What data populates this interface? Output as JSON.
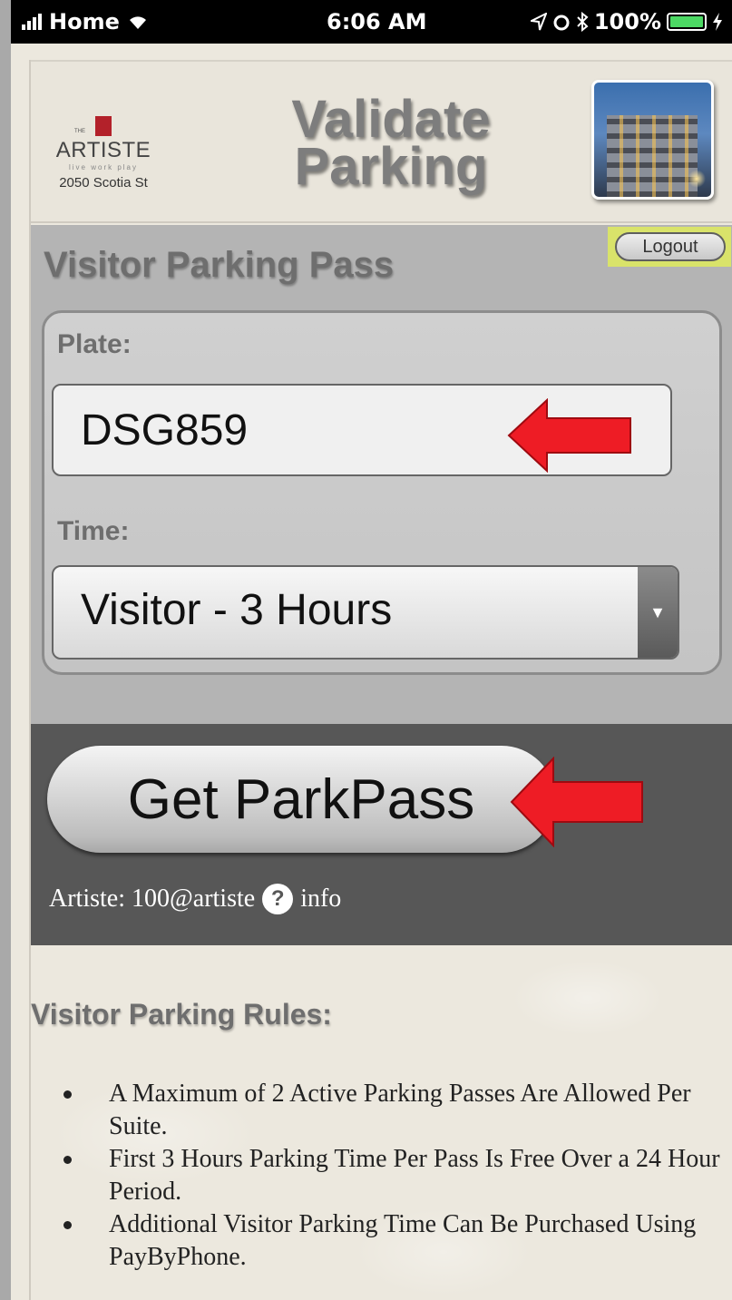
{
  "status_bar": {
    "carrier": "Home",
    "time": "6:06 AM",
    "battery": "100%"
  },
  "header": {
    "logo_small": "THE",
    "logo_name": "ARTISTE",
    "logo_tagline": "live work play",
    "address": "2050 Scotia St",
    "title_line1": "Validate",
    "title_line2": "Parking"
  },
  "pass": {
    "title": "Visitor Parking Pass",
    "logout_label": "Logout",
    "plate_label": "Plate:",
    "plate_value": "DSG859",
    "time_label": "Time:",
    "time_value": "Visitor - 3 Hours",
    "get_button_label": "Get ParkPass",
    "account_text": "Artiste: 100@artiste",
    "info_label": "info"
  },
  "rules": {
    "title": "Visitor Parking Rules:",
    "items": [
      "A Maximum of 2 Active Parking Passes Are Allowed Per Suite.",
      "First 3 Hours Parking Time Per Pass Is Free Over a 24 Hour Period.",
      "Additional Visitor Parking Time Can Be Purchased Using PayByPhone."
    ]
  },
  "colors": {
    "annotation_arrow": "#ee1c25",
    "logout_highlight": "#d9e36a",
    "action_band": "#575757"
  },
  "icons": [
    "signal-icon",
    "wifi-icon",
    "location-icon",
    "alarm-icon",
    "bluetooth-icon",
    "battery-icon",
    "charging-icon",
    "help-icon",
    "dropdown-arrow-icon",
    "arrow-annotation-icon"
  ]
}
